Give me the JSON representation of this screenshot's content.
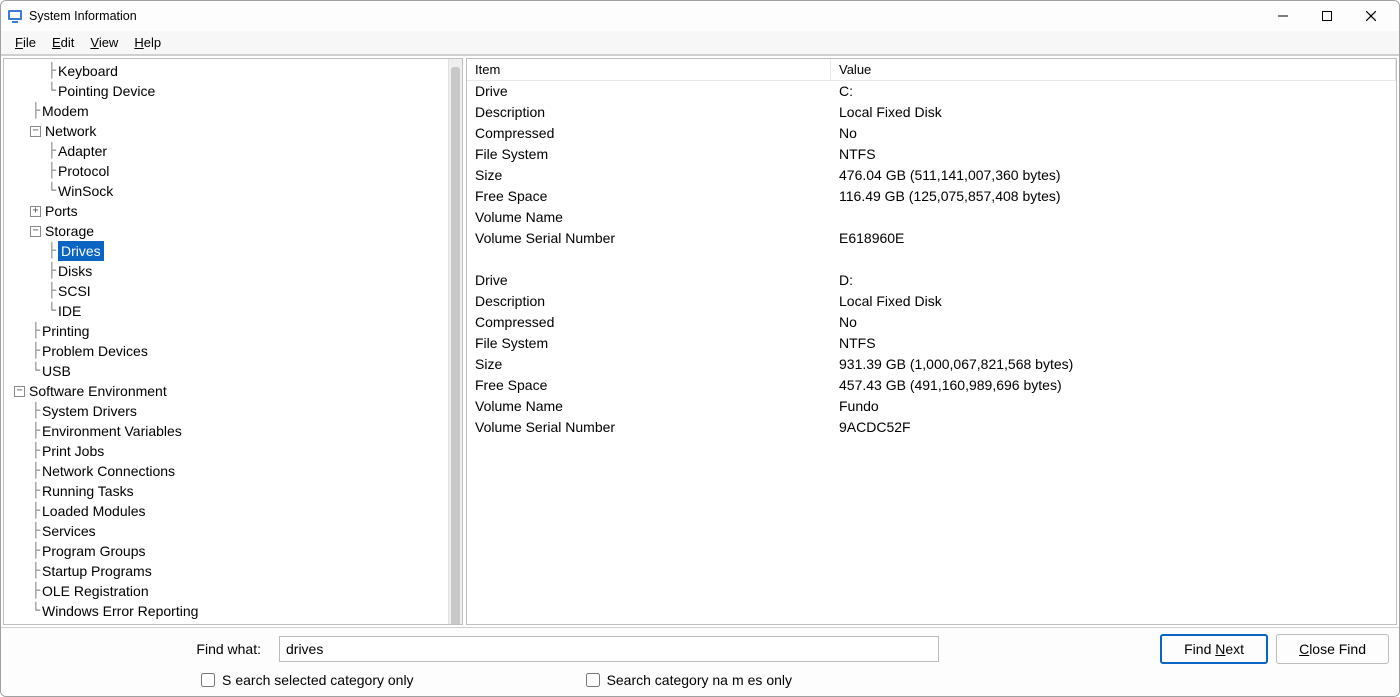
{
  "window": {
    "title": "System Information"
  },
  "menu": {
    "file": "File",
    "edit": "Edit",
    "view": "View",
    "help": "Help"
  },
  "tree": {
    "keyboard": "Keyboard",
    "pointing": "Pointing Device",
    "modem": "Modem",
    "network": "Network",
    "adapter": "Adapter",
    "protocol": "Protocol",
    "winsock": "WinSock",
    "ports": "Ports",
    "storage": "Storage",
    "drives": "Drives",
    "disks": "Disks",
    "scsi": "SCSI",
    "ide": "IDE",
    "printing": "Printing",
    "problem": "Problem Devices",
    "usb": "USB",
    "softenv": "Software Environment",
    "sysdrivers": "System Drivers",
    "envvars": "Environment Variables",
    "printjobs": "Print Jobs",
    "netconn": "Network Connections",
    "running": "Running Tasks",
    "loaded": "Loaded Modules",
    "services": "Services",
    "proggroups": "Program Groups",
    "startup": "Startup Programs",
    "olereg": "OLE Registration",
    "wer": "Windows Error Reporting"
  },
  "details": {
    "header": {
      "item": "Item",
      "value": "Value"
    },
    "rows": {
      "drive_c_label": "Drive",
      "drive_c_value": "C:",
      "desc_c_label": "Description",
      "desc_c_value": "Local Fixed Disk",
      "comp_c_label": "Compressed",
      "comp_c_value": "No",
      "fs_c_label": "File System",
      "fs_c_value": "NTFS",
      "size_c_label": "Size",
      "size_c_value": "476.04 GB (511,141,007,360 bytes)",
      "free_c_label": "Free Space",
      "free_c_value": "116.49 GB (125,075,857,408 bytes)",
      "vname_c_label": "Volume Name",
      "vname_c_value": "",
      "vsn_c_label": "Volume Serial Number",
      "vsn_c_value": "E618960E",
      "drive_d_label": "Drive",
      "drive_d_value": "D:",
      "desc_d_label": "Description",
      "desc_d_value": "Local Fixed Disk",
      "comp_d_label": "Compressed",
      "comp_d_value": "No",
      "fs_d_label": "File System",
      "fs_d_value": "NTFS",
      "size_d_label": "Size",
      "size_d_value": "931.39 GB (1,000,067,821,568 bytes)",
      "free_d_label": "Free Space",
      "free_d_value": "457.43 GB (491,160,989,696 bytes)",
      "vname_d_label": "Volume Name",
      "vname_d_value": "Fundo",
      "vsn_d_label": "Volume Serial Number",
      "vsn_d_value": "9ACDC52F"
    }
  },
  "find": {
    "label": "Find what:",
    "value": "drives",
    "find_next": "Find Next",
    "close_find": "Close Find",
    "chk1": "Search selected category only",
    "chk2": "Search category names only"
  }
}
